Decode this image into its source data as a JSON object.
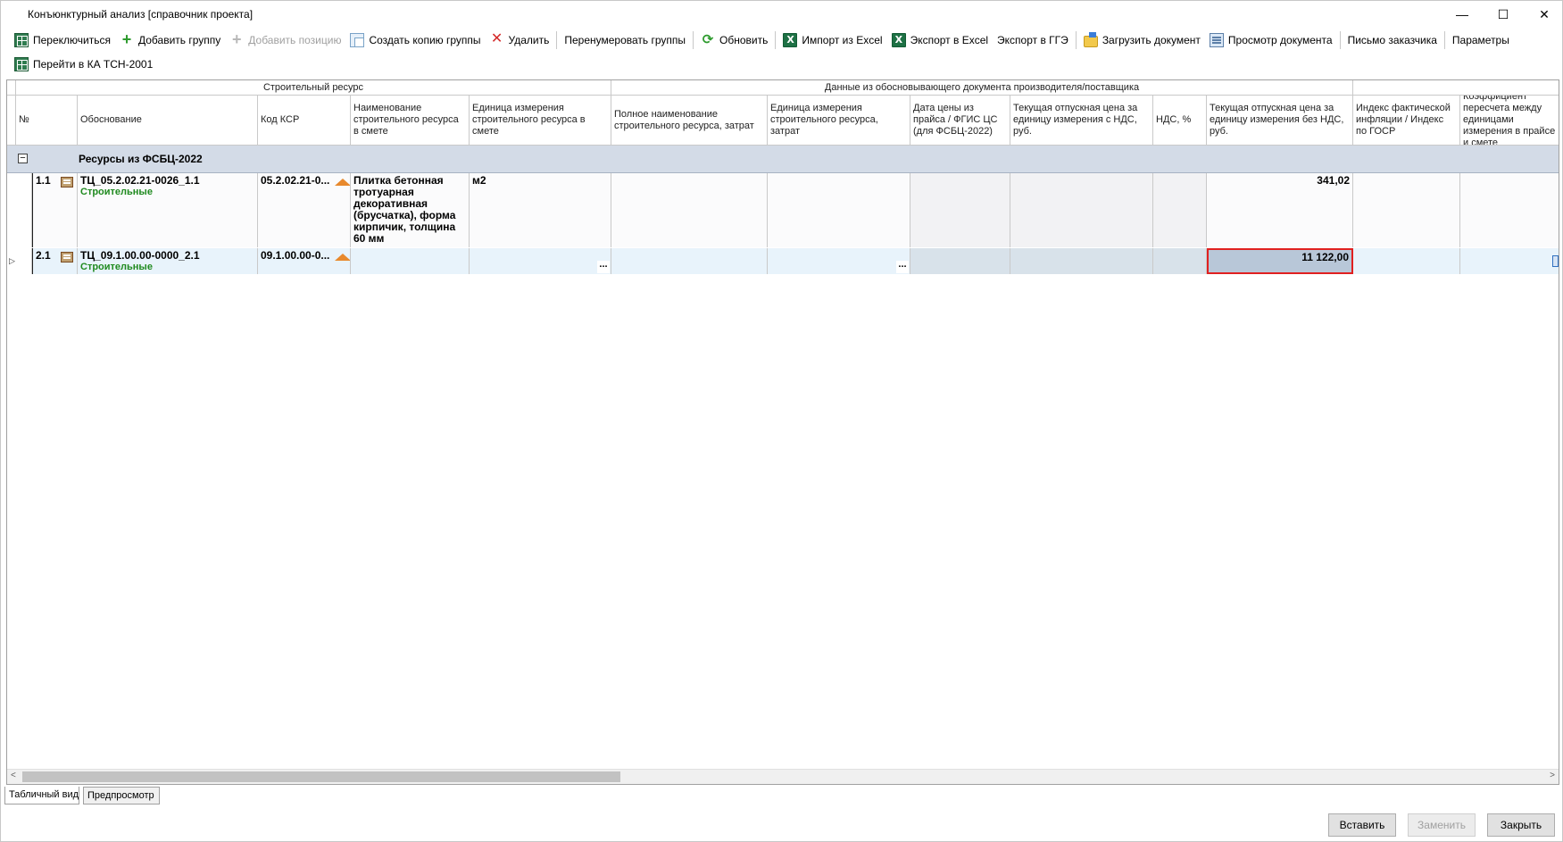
{
  "window": {
    "title": "Конъюнктурный анализ [справочник проекта]",
    "controls": {
      "minimize": "—",
      "maximize": "☐",
      "close": "✕"
    }
  },
  "toolbar1": {
    "switch": "Переключиться",
    "add_group": "Добавить группу",
    "add_position": "Добавить позицию",
    "copy_group": "Создать копию группы",
    "delete": "Удалить",
    "renumber": "Перенумеровать группы",
    "refresh": "Обновить",
    "import_excel": "Импорт из Excel",
    "export_excel": "Экспорт в Excel",
    "export_gge": "Экспорт в ГГЭ",
    "load_doc": "Загрузить документ",
    "view_doc": "Просмотр документа",
    "letter": "Письмо заказчика",
    "params": "Параметры"
  },
  "toolbar2": {
    "goto_ka": "Перейти в КА ТСН-2001"
  },
  "grid": {
    "group_headers": {
      "resource": "Строительный ресурс",
      "supplier": "Данные из обосновывающего документа производителя/поставщика"
    },
    "columns": {
      "num": "№",
      "basis": "Обоснование",
      "ksr": "Код КСР",
      "name": "Наименование строительного ресурса в смете",
      "unit": "Единица измерения строительного ресурса в смете",
      "fullname": "Полное наименование строительного ресурса, затрат",
      "unit2": "Единица измерения строительного ресурса, затрат",
      "date": "Дата цены из прайса / ФГИС ЦС (для ФСБЦ-2022)",
      "price_vat": "Текущая отпускная цена за единицу измерения с НДС, руб.",
      "vat": "НДС, %",
      "price_novat": "Текущая отпускная цена за единицу измерения без НДС, руб.",
      "index": "Индекс фактической инфляции /  Индекс по  ГОСР",
      "coef": "Коэффициент пересчета между единицами измерения в прайсе и смете"
    },
    "group": {
      "expander": "−",
      "label": "Ресурсы из ФСБЦ-2022"
    },
    "rows": [
      {
        "num": "1.1",
        "basis": "ТЦ_05.2.02.21-0026_1.1",
        "category": "Строительные",
        "ksr": "05.2.02.21-0...",
        "name": "Плитка бетонная тротуарная декоративная (брусчатка), форма кирпичик, толщина 60 мм",
        "unit": "м2",
        "price_novat": "341,02"
      },
      {
        "num": "2.1",
        "basis": "ТЦ_09.1.00.00-0000_2.1",
        "category": "Строительные",
        "ksr": "09.1.00.00-0...",
        "name": "",
        "unit": "",
        "ellipsis": "...",
        "price_novat": "11 122,00"
      }
    ]
  },
  "tabs": {
    "table_view": "Табличный вид",
    "preview": "Предпросмотр"
  },
  "buttons": {
    "insert": "Вставить",
    "replace": "Заменить",
    "close": "Закрыть"
  },
  "colors": {
    "group_row": "#d3dbe7",
    "selected_row": "#e8f3fb",
    "highlight_border": "#e02020",
    "category_text": "#1f8a1f"
  }
}
